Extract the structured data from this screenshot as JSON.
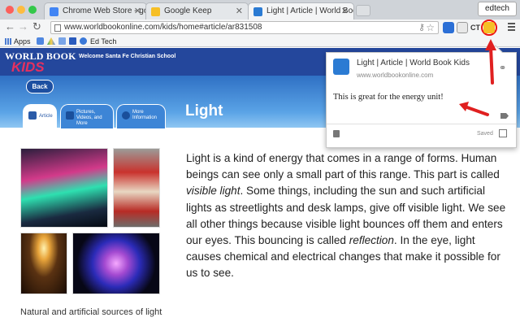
{
  "browser": {
    "tabs": [
      {
        "label": "Chrome Web Store - googl",
        "fav": "#4285f4"
      },
      {
        "label": "Google Keep",
        "fav": "#f6bf26"
      },
      {
        "label": "Light | Article | World Book",
        "fav": "#2b7bd3"
      }
    ],
    "profile": "edtech",
    "url": "www.worldbookonline.com/kids/home#article/ar831508",
    "bookmarks": {
      "apps": "Apps",
      "ed_tech": "Ed Tech"
    },
    "ext_ct": "CT"
  },
  "page": {
    "brand_top": "WORLD BOOK",
    "brand_kids": "KIDS",
    "welcome": "Welcome Santa Fe Christian School",
    "back": "Back",
    "tabs": [
      {
        "label": "Article"
      },
      {
        "label": "Pictures, Videos, and More"
      },
      {
        "label": "More Information"
      }
    ],
    "title": "Light",
    "caption": "Natural and artificial sources of light"
  },
  "article": {
    "t1": "Light is a kind of energy that comes in a range of forms. Human beings can see only a small part of this range. This part is called ",
    "em1": "visible light",
    "t2": ". Some things, including the sun and such artificial lights as streetlights and desk lamps, give off visible light. We see all other things because visible light bounces off them and enters our eyes. This bouncing is called ",
    "em2": "reflection",
    "t3": ". In the eye, light causes chemical and electrical changes that make it possible for us to see."
  },
  "keep_popup": {
    "title": "Light | Article | World Book Kids",
    "url": "www.worldbookonline.com",
    "note": "This is great for the energy unit!",
    "status": "Saved"
  }
}
